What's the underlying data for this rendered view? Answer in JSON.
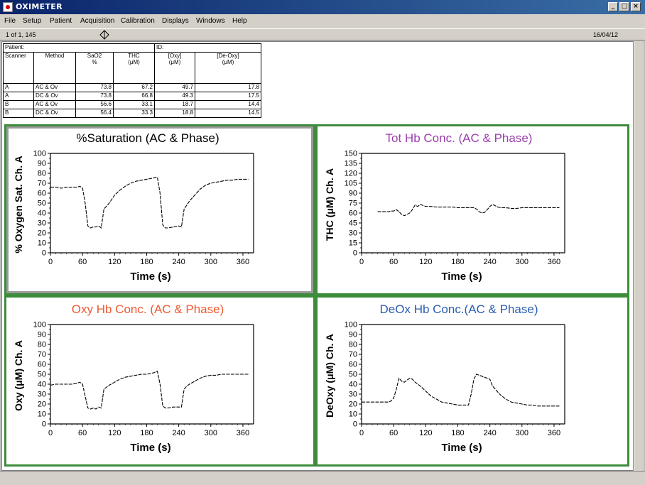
{
  "window": {
    "title": "OXIMETER",
    "minimize_glyph": "_",
    "maximize_glyph": "□",
    "close_glyph": "×"
  },
  "menu": {
    "items": [
      "File",
      "Setup",
      "Patient",
      "Acquisition",
      "Calibration",
      "Displays",
      "Windows",
      "Help"
    ]
  },
  "status": {
    "record": "1 of 1, 145",
    "date": "16/04/12"
  },
  "table": {
    "patient_label": "Patient:",
    "id_label": "ID:",
    "headers": [
      [
        "Scanner",
        ""
      ],
      [
        "Method",
        ""
      ],
      [
        "SaO2",
        "%"
      ],
      [
        "THC",
        "(μM)"
      ],
      [
        "[Oxy]",
        "(μM)"
      ],
      [
        "[De-Oxy]",
        "(μM)"
      ]
    ],
    "rows": [
      [
        "A",
        "AC & Ov",
        "73.8",
        "67.2",
        "49.7",
        "17.8"
      ],
      [
        "A",
        "DC & Ov",
        "73.8",
        "66.8",
        "49.3",
        "17.5"
      ],
      [
        "B",
        "AC & Ov",
        "56.6",
        "33.1",
        "18.7",
        "14.4"
      ],
      [
        "B",
        "DC & Ov",
        "56.4",
        "33.3",
        "18.8",
        "14.5"
      ]
    ]
  },
  "colors": {
    "panel_border": "#3c8c3c",
    "title_black": "#000000",
    "title_purple": "#9b3fae",
    "title_orange": "#f05a30",
    "title_blue": "#2a5db0"
  },
  "chart_data": [
    {
      "type": "line",
      "title": "%Saturation (AC & Phase)",
      "ylabel": "% Oxygen Sat. Ch. A",
      "xlabel": "Time (s)",
      "xlim": [
        0,
        380
      ],
      "ylim": [
        0,
        100
      ],
      "xticks": [
        0,
        60,
        120,
        180,
        240,
        300,
        360
      ],
      "yticks": [
        0,
        10,
        20,
        30,
        40,
        50,
        60,
        70,
        80,
        90,
        100
      ],
      "x": [
        0,
        10,
        20,
        30,
        40,
        50,
        55,
        60,
        65,
        70,
        75,
        80,
        85,
        90,
        95,
        100,
        105,
        110,
        120,
        130,
        140,
        150,
        160,
        170,
        180,
        190,
        200,
        205,
        210,
        215,
        220,
        230,
        240,
        245,
        250,
        255,
        260,
        270,
        280,
        290,
        300,
        310,
        320,
        330,
        340,
        350,
        360,
        370
      ],
      "series": [
        {
          "values": [
            66,
            66,
            65,
            66,
            66,
            66,
            67,
            65,
            50,
            27,
            25,
            26,
            26,
            27,
            25,
            44,
            47,
            50,
            58,
            63,
            67,
            70,
            72,
            73,
            74,
            75,
            76,
            60,
            28,
            25,
            25,
            26,
            27,
            26,
            44,
            48,
            52,
            58,
            64,
            68,
            70,
            71,
            72,
            73,
            73,
            74,
            74,
            74
          ]
        }
      ]
    },
    {
      "type": "line",
      "title": "Tot Hb Conc. (AC & Phase)",
      "ylabel": "THC (μM) Ch. A",
      "xlabel": "Time (s)",
      "xlim": [
        0,
        380
      ],
      "ylim": [
        0,
        150
      ],
      "xticks": [
        0,
        60,
        120,
        180,
        240,
        300,
        360
      ],
      "yticks": [
        0,
        15,
        30,
        45,
        60,
        75,
        90,
        105,
        120,
        135,
        150
      ],
      "x": [
        30,
        40,
        50,
        55,
        60,
        65,
        70,
        75,
        80,
        85,
        90,
        95,
        100,
        105,
        110,
        120,
        130,
        140,
        150,
        160,
        170,
        180,
        190,
        200,
        210,
        215,
        220,
        225,
        230,
        235,
        240,
        245,
        250,
        255,
        260,
        270,
        280,
        290,
        300,
        310,
        320,
        330,
        340,
        350,
        360,
        370
      ],
      "series": [
        {
          "values": [
            62,
            62,
            62,
            63,
            63,
            65,
            62,
            58,
            56,
            58,
            60,
            65,
            72,
            70,
            73,
            70,
            70,
            69,
            69,
            69,
            69,
            68,
            68,
            68,
            68,
            66,
            62,
            60,
            61,
            65,
            70,
            73,
            71,
            69,
            68,
            68,
            67,
            67,
            68,
            68,
            68,
            68,
            68,
            68,
            68,
            68
          ]
        }
      ]
    },
    {
      "type": "line",
      "title": "Oxy Hb Conc. (AC & Phase)",
      "ylabel": "Oxy (μM) Ch. A",
      "xlabel": "Time (s)",
      "xlim": [
        0,
        380
      ],
      "ylim": [
        0,
        100
      ],
      "xticks": [
        0,
        60,
        120,
        180,
        240,
        300,
        360
      ],
      "yticks": [
        0,
        10,
        20,
        30,
        40,
        50,
        60,
        70,
        80,
        90,
        100
      ],
      "x": [
        0,
        10,
        20,
        30,
        40,
        50,
        55,
        60,
        65,
        70,
        75,
        80,
        85,
        90,
        95,
        100,
        105,
        110,
        120,
        130,
        140,
        150,
        160,
        170,
        180,
        190,
        200,
        205,
        210,
        215,
        220,
        230,
        240,
        245,
        250,
        255,
        260,
        270,
        280,
        290,
        300,
        310,
        320,
        330,
        340,
        350,
        360,
        370
      ],
      "series": [
        {
          "values": [
            39,
            40,
            40,
            40,
            40,
            41,
            42,
            40,
            28,
            16,
            15,
            16,
            15,
            17,
            16,
            35,
            37,
            39,
            42,
            45,
            47,
            48,
            49,
            50,
            50,
            51,
            53,
            40,
            18,
            16,
            16,
            17,
            17,
            17,
            35,
            38,
            40,
            43,
            46,
            48,
            49,
            49,
            50,
            50,
            50,
            50,
            50,
            50
          ]
        }
      ]
    },
    {
      "type": "line",
      "title": "DeOx Hb Conc.(AC & Phase)",
      "ylabel": "DeOxy (μM) Ch. A",
      "xlabel": "Time (s)",
      "xlim": [
        0,
        380
      ],
      "ylim": [
        0,
        100
      ],
      "xticks": [
        0,
        60,
        120,
        180,
        240,
        300,
        360
      ],
      "yticks": [
        0,
        10,
        20,
        30,
        40,
        50,
        60,
        70,
        80,
        90,
        100
      ],
      "x": [
        0,
        10,
        20,
        30,
        40,
        50,
        55,
        60,
        65,
        70,
        75,
        80,
        85,
        90,
        95,
        100,
        105,
        110,
        120,
        130,
        140,
        150,
        160,
        170,
        180,
        190,
        200,
        205,
        210,
        215,
        220,
        230,
        240,
        245,
        250,
        255,
        260,
        270,
        280,
        290,
        300,
        310,
        320,
        330,
        340,
        350,
        360,
        370
      ],
      "series": [
        {
          "values": [
            22,
            22,
            22,
            22,
            22,
            22,
            23,
            26,
            35,
            46,
            43,
            42,
            44,
            46,
            45,
            42,
            40,
            38,
            33,
            28,
            25,
            22,
            21,
            20,
            19,
            19,
            19,
            30,
            45,
            50,
            49,
            47,
            45,
            38,
            35,
            32,
            29,
            25,
            22,
            21,
            20,
            19,
            19,
            18,
            18,
            18,
            18,
            18
          ]
        }
      ]
    }
  ]
}
